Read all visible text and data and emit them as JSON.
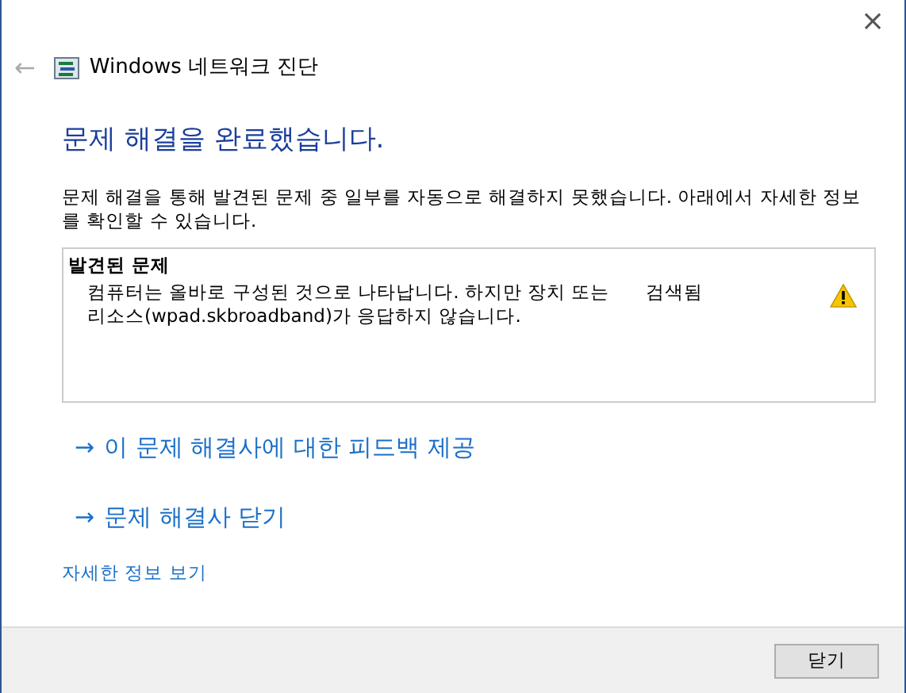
{
  "window": {
    "close": "×",
    "back": "←",
    "title": "Windows 네트워크 진단"
  },
  "heading": "문제 해결을 완료했습니다.",
  "description": "문제 해결을 통해 발견된 문제 중 일부를 자동으로 해결하지 못했습니다. 아래에서 자세한 정보를 확인할 수 있습니다.",
  "problems": {
    "title": "발견된 문제",
    "items": [
      {
        "text": "컴퓨터는 올바로 구성된 것으로 나타납니다. 하지만 장치 또는 리소스(wpad.skbroadband)가 응답하지 않습니다.",
        "status": "검색됨",
        "kind": "warning"
      }
    ]
  },
  "links": [
    {
      "arrow": "→",
      "label": "이 문제 해결사에 대한 피드백 제공"
    },
    {
      "arrow": "→",
      "label": "문제 해결사 닫기"
    }
  ],
  "details_link": "자세한 정보 보기",
  "buttons": [
    "닫기"
  ]
}
